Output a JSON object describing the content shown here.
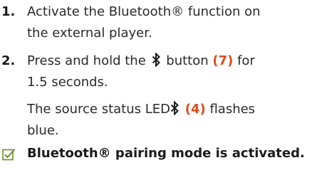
{
  "steps": [
    {
      "number": "1.",
      "line1": "Activate the Bluetooth® function on",
      "line2": "the external player."
    },
    {
      "number": "2.",
      "line1_before": "Press and hold the",
      "line1_after": "button",
      "ref1": "(7)",
      "line1_end": "for",
      "line2": "1.5 seconds.",
      "line3_before": "The source status LED",
      "ref2": "(4)",
      "line3_after": "flashes",
      "line4": "blue."
    }
  ],
  "result": {
    "icon": "checkbox-check-icon",
    "text": "Bluetooth® pairing mode is activated."
  },
  "colors": {
    "text": "#2a2a2a",
    "reference": "#e04a1a",
    "check": "#6a8f2a"
  }
}
